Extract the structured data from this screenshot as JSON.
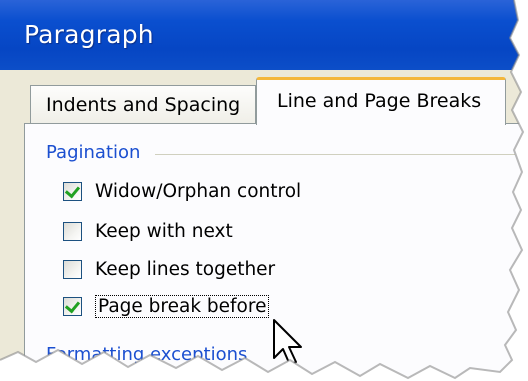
{
  "window": {
    "title": "Paragraph"
  },
  "tabs": [
    {
      "label": "Indents and Spacing",
      "active": false
    },
    {
      "label": "Line and Page Breaks",
      "active": true
    }
  ],
  "pagination": {
    "group_label": "Pagination",
    "options": [
      {
        "label": "Widow/Orphan control",
        "checked": true
      },
      {
        "label": "Keep with next",
        "checked": false
      },
      {
        "label": "Keep lines together",
        "checked": false
      },
      {
        "label": "Page break before",
        "checked": true,
        "focused": true
      }
    ]
  },
  "formatting": {
    "group_label": "Formatting exceptions"
  },
  "colors": {
    "titlebar": "#0646c4",
    "tab_accent": "#f4b73b",
    "group_label": "#1b4fd0",
    "checkmark": "#21a121"
  },
  "icons": {
    "cursor": "arrow-cursor-icon"
  }
}
